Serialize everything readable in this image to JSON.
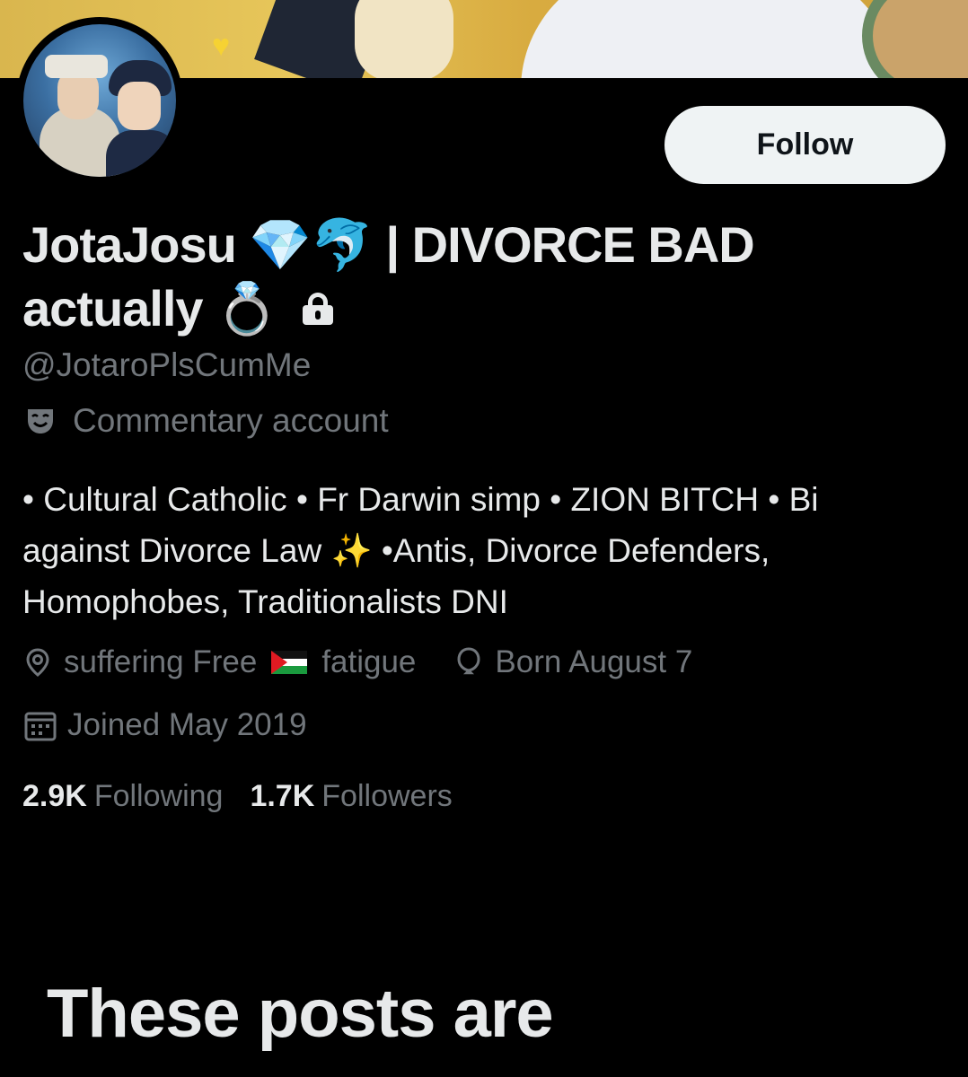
{
  "profile": {
    "display_name_main": "JotaJosu",
    "gem_emoji": "💎",
    "dolphin_emoji": "🐬",
    "display_name_rest": "| DIVORCE BAD",
    "display_name_line2": "actually",
    "ring_emoji": "💍",
    "handle": "@JotaroPlsCumMe",
    "category": "Commentary account",
    "bio_line1": "• Cultural Catholic • Fr Darwin simp • ZION BITCH • Bi",
    "bio_line2a": "against Divorce Law",
    "sparkle_emoji": "✨",
    "bio_line2b": "•Antis, Divorce Defenders,",
    "bio_line3": "Homophobes, Traditionalists DNI",
    "location_pre": "suffering Free",
    "location_post": "fatigue",
    "birthday": "Born August 7",
    "joined": "Joined May 2019",
    "following_count": "2.9K",
    "following_label": "Following",
    "followers_count": "1.7K",
    "followers_label": "Followers"
  },
  "actions": {
    "follow_label": "Follow"
  },
  "protected_notice": {
    "title": "These posts are"
  },
  "colors": {
    "background": "#000000",
    "primary_text": "#e7e9ea",
    "secondary_text": "#71767b",
    "follow_button_bg": "#eff3f4"
  }
}
